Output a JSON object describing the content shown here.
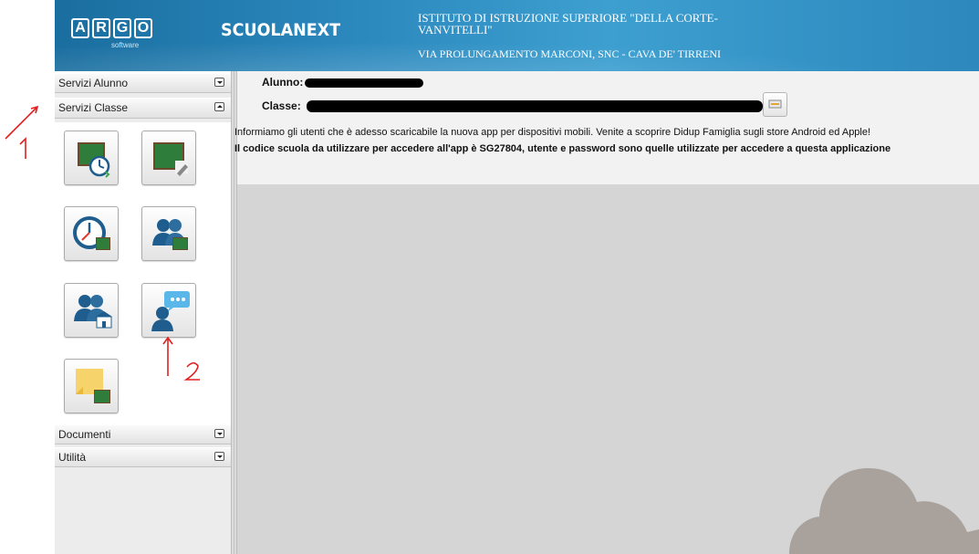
{
  "header": {
    "logo_letters": [
      "A",
      "R",
      "G",
      "O"
    ],
    "logo_sub": "software",
    "product": "SCUOLANEXT",
    "school_name": "ISTITUTO DI ISTRUZIONE SUPERIORE \"DELLA CORTE-VANVITELLI\"",
    "school_address": "VIA PROLUNGAMENTO MARCONI, SNC - CAVA DE' TIRRENI"
  },
  "sidebar": {
    "sections": [
      {
        "label": "Servizi Alunno",
        "state": "collapsed"
      },
      {
        "label": "Servizi Classe",
        "state": "expanded"
      },
      {
        "label": "Documenti",
        "state": "collapsed"
      },
      {
        "label": "Utilità",
        "state": "collapsed"
      }
    ],
    "tiles": [
      {
        "icon": "class-schedule-icon"
      },
      {
        "icon": "class-board-edit-icon"
      },
      {
        "icon": "timetable-clock-icon"
      },
      {
        "icon": "class-students-icon"
      },
      {
        "icon": "school-students-icon"
      },
      {
        "icon": "teacher-message-icon"
      },
      {
        "icon": "class-notes-icon"
      }
    ]
  },
  "main": {
    "alunno_label": "Alunno:",
    "classe_label": "Classe:",
    "info_line1": "Informiamo gli utenti che è adesso scaricabile la nuova app per dispositivi mobili. Venite a scoprire Didup Famiglia sugli store Android ed Apple!",
    "info_line2": "Il codice scuola da utilizzare per accedere all'app è SG27804, utente e password sono quelle utilizzate per accedere a questa applicazione"
  },
  "annotations": {
    "mark1": "1",
    "mark2": "2"
  },
  "colors": {
    "header_blue": "#2a86bb",
    "annotation_red": "#e02020",
    "cloud": "#a8a19c"
  }
}
